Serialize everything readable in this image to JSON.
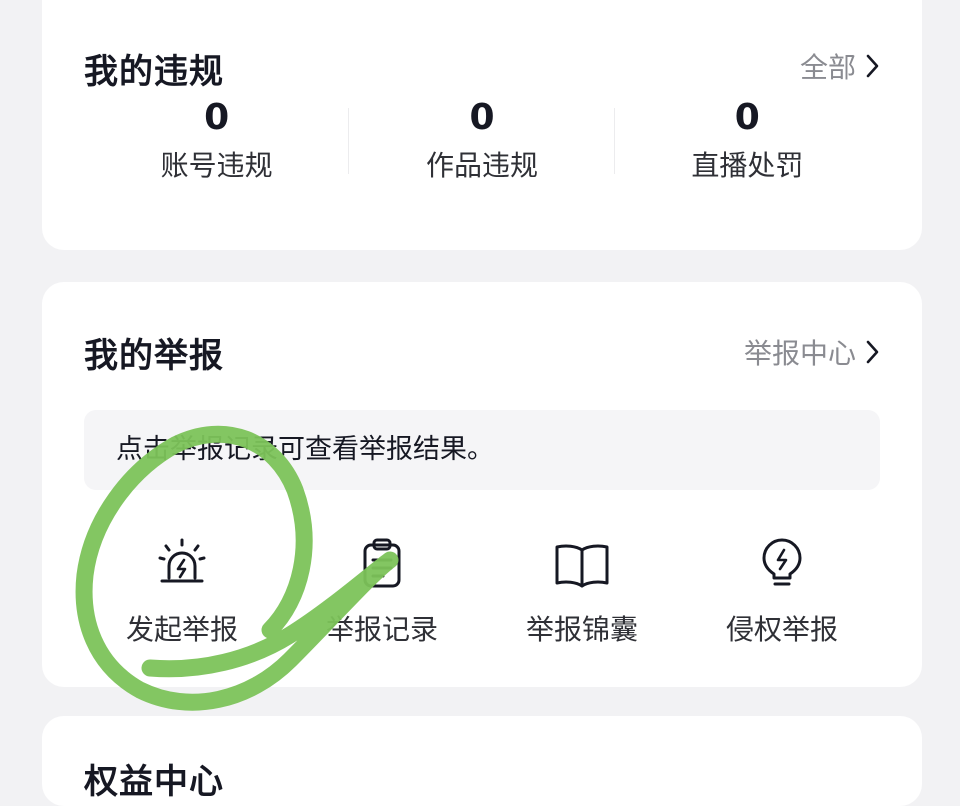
{
  "violations": {
    "title": "我的违规",
    "link_label": "全部",
    "stats": [
      {
        "value": "0",
        "label": "账号违规"
      },
      {
        "value": "0",
        "label": "作品违规"
      },
      {
        "value": "0",
        "label": "直播处罚"
      }
    ]
  },
  "reports": {
    "title": "我的举报",
    "link_label": "举报中心",
    "notice": "点击举报记录可查看举报结果。",
    "actions": [
      {
        "label": "发起举报",
        "icon": "alarm-lightning-icon"
      },
      {
        "label": "举报记录",
        "icon": "clipboard-icon"
      },
      {
        "label": "举报锦囊",
        "icon": "book-icon"
      },
      {
        "label": "侵权举报",
        "icon": "lightbulb-icon"
      }
    ]
  },
  "next_section": {
    "title": "权益中心"
  },
  "annotation": {
    "color": "#7cc35a"
  }
}
